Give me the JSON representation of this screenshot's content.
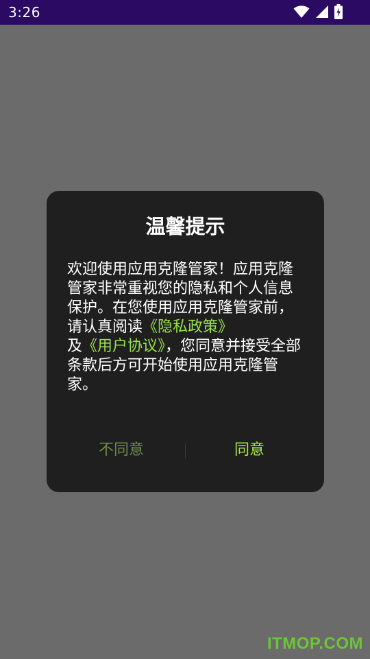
{
  "status_bar": {
    "time": "3:26",
    "icons": [
      "wifi-icon",
      "cell-signal-icon",
      "battery-charging-icon"
    ],
    "background": "#2a0a63"
  },
  "dialog": {
    "title": "温馨提示",
    "body": {
      "text_1": "欢迎使用应用克隆管家！应用克隆管家非常重视您的隐私和个人信息保护。在您使用应用克隆管家前，请认真阅读",
      "privacy_link": "《隐私政策》",
      "text_2": "及",
      "agreement_link": "《用户协议》",
      "text_3": "，您同意并接受全部条款后方可开始使用应用克隆管家。"
    },
    "disagree_label": "不同意",
    "agree_label": "同意",
    "link_color": "#9ae34a",
    "background": "#1f1f1f"
  },
  "watermark": "ITMOP.COM"
}
